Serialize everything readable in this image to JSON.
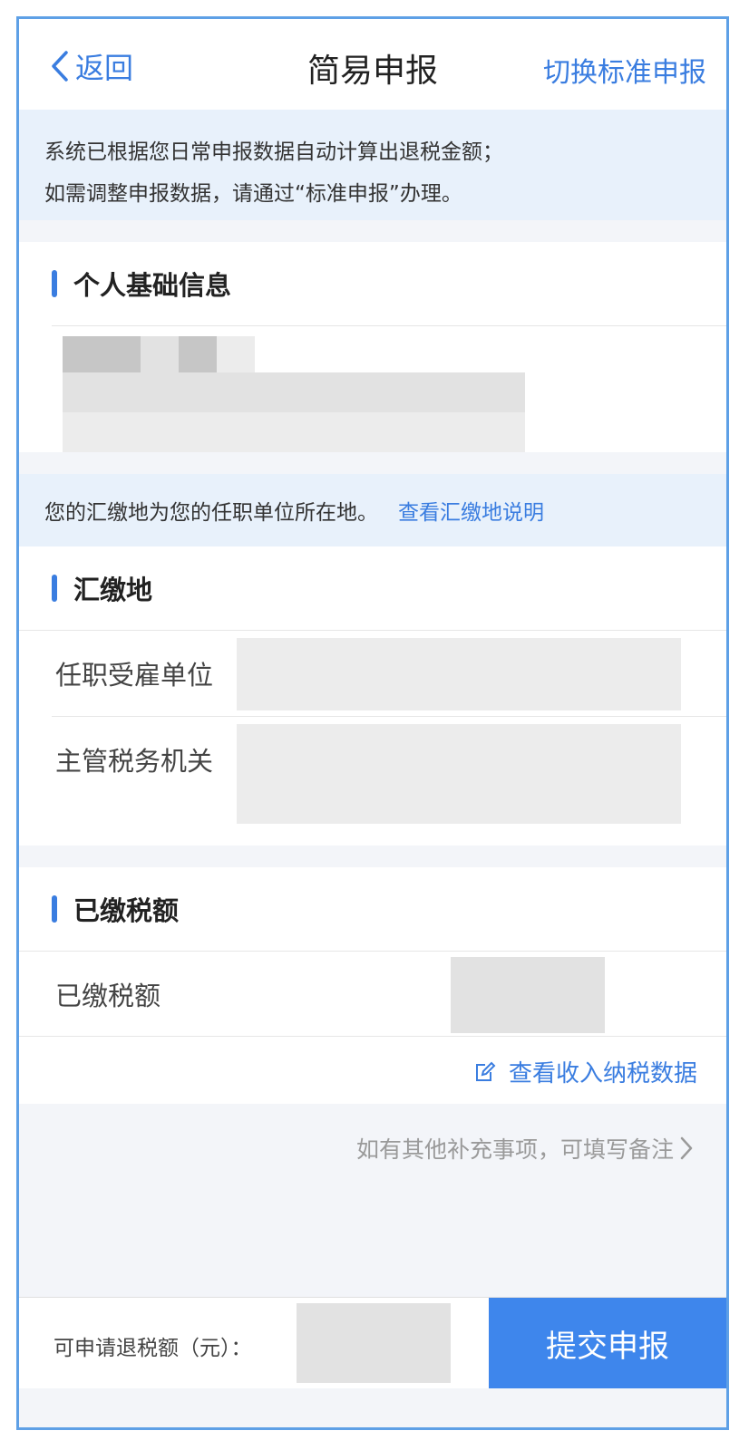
{
  "nav": {
    "back_label": "返回",
    "title": "简易申报",
    "switch_label": "切换标准申报"
  },
  "notice": {
    "line1": "系统已根据您日常申报数据自动计算出退税金额；",
    "line2": "如需调整申报数据，请通过“标准申报”办理。"
  },
  "personal": {
    "title": "个人基础信息"
  },
  "location_notice": {
    "text": "您的汇缴地为您的任职单位所在地。",
    "link": "查看汇缴地说明"
  },
  "settlement": {
    "title": "汇缴地",
    "employer_label": "任职受雇单位",
    "tax_authority_label": "主管税务机关"
  },
  "paid_tax": {
    "title": "已缴税额",
    "row_label": "已缴税额"
  },
  "income_link": "查看收入纳税数据",
  "remark_link": "如有其他补充事项，可填写备注",
  "bottom": {
    "refund_label": "可申请退税额（元）：",
    "submit_label": "提交申报"
  },
  "colors": {
    "accent": "#3a7de0",
    "notice_bg": "#e8f1fb",
    "button": "#3e86ec"
  }
}
